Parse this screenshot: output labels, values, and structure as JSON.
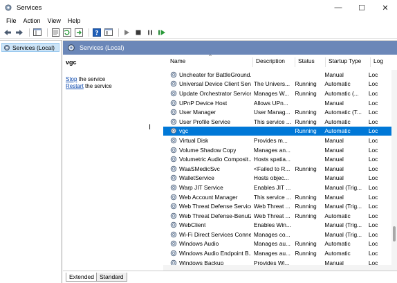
{
  "window": {
    "title": "Services",
    "minimize": "—",
    "maximize": "☐",
    "close": "✕"
  },
  "menu": [
    "File",
    "Action",
    "View",
    "Help"
  ],
  "tree": {
    "root_label": "Services (Local)"
  },
  "pane": {
    "header": "Services (Local)",
    "selected_service": "vgc",
    "stop_link": "Stop",
    "stop_suffix": " the service",
    "restart_link": "Restart",
    "restart_suffix": " the service"
  },
  "columns": {
    "name": "Name",
    "description": "Description",
    "status": "Status",
    "startup": "Startup Type",
    "log": "Log"
  },
  "services": [
    {
      "name": "Uncheater for BattleGround...",
      "description": "",
      "status": "",
      "startup": "Manual",
      "log": "Loc"
    },
    {
      "name": "Universal Device Client Serv...",
      "description": "The Univers...",
      "status": "Running",
      "startup": "Automatic",
      "log": "Loc"
    },
    {
      "name": "Update Orchestrator Service",
      "description": "Manages W...",
      "status": "Running",
      "startup": "Automatic (...",
      "log": "Loc"
    },
    {
      "name": "UPnP Device Host",
      "description": "Allows UPn...",
      "status": "",
      "startup": "Manual",
      "log": "Loc"
    },
    {
      "name": "User Manager",
      "description": "User Manag...",
      "status": "Running",
      "startup": "Automatic (T...",
      "log": "Loc"
    },
    {
      "name": "User Profile Service",
      "description": "This service ...",
      "status": "Running",
      "startup": "Automatic",
      "log": "Loc"
    },
    {
      "name": "vgc",
      "description": "",
      "status": "Running",
      "startup": "Automatic",
      "log": "Loc"
    },
    {
      "name": "Virtual Disk",
      "description": "Provides m...",
      "status": "",
      "startup": "Manual",
      "log": "Loc"
    },
    {
      "name": "Volume Shadow Copy",
      "description": "Manages an...",
      "status": "",
      "startup": "Manual",
      "log": "Loc"
    },
    {
      "name": "Volumetric Audio Composit...",
      "description": "Hosts spatia...",
      "status": "",
      "startup": "Manual",
      "log": "Loc"
    },
    {
      "name": "WaaSMedicSvc",
      "description": "<Failed to R...",
      "status": "Running",
      "startup": "Manual",
      "log": "Loc"
    },
    {
      "name": "WalletService",
      "description": "Hosts objec...",
      "status": "",
      "startup": "Manual",
      "log": "Loc"
    },
    {
      "name": "Warp JIT Service",
      "description": "Enables JIT ...",
      "status": "",
      "startup": "Manual (Trig...",
      "log": "Loc"
    },
    {
      "name": "Web Account Manager",
      "description": "This service ...",
      "status": "Running",
      "startup": "Manual",
      "log": "Loc"
    },
    {
      "name": "Web Threat Defense Service",
      "description": "Web Threat ...",
      "status": "Running",
      "startup": "Manual (Trig...",
      "log": "Loc"
    },
    {
      "name": "Web Threat Defense-Benutz...",
      "description": "Web Threat ...",
      "status": "Running",
      "startup": "Automatic",
      "log": "Loc"
    },
    {
      "name": "WebClient",
      "description": "Enables Win...",
      "status": "",
      "startup": "Manual (Trig...",
      "log": "Loc"
    },
    {
      "name": "Wi-Fi Direct Services Conne...",
      "description": "Manages co...",
      "status": "",
      "startup": "Manual (Trig...",
      "log": "Loc"
    },
    {
      "name": "Windows Audio",
      "description": "Manages au...",
      "status": "Running",
      "startup": "Automatic",
      "log": "Loc"
    },
    {
      "name": "Windows Audio Endpoint B...",
      "description": "Manages au...",
      "status": "Running",
      "startup": "Automatic",
      "log": "Loc"
    },
    {
      "name": "Windows Backup",
      "description": "Provides Wi...",
      "status": "",
      "startup": "Manual",
      "log": "Loc"
    }
  ],
  "selected_index": 6,
  "tabs": [
    "Extended",
    "Standard"
  ],
  "colors": {
    "pane_header": "#6b87b8",
    "selection": "#0078d7",
    "link": "#0645ad"
  },
  "icons": {
    "title": "services-gear-icon",
    "tree": "services-gear-icon",
    "row": "service-gear-icon",
    "toolbar": [
      "back-arrow-icon",
      "forward-arrow-icon",
      "console-tree-icon",
      "properties-icon",
      "refresh-icon",
      "export-list-icon",
      "help-icon",
      "mmc-view-icon",
      "start-icon",
      "stop-icon",
      "pause-icon",
      "restart-icon"
    ]
  }
}
